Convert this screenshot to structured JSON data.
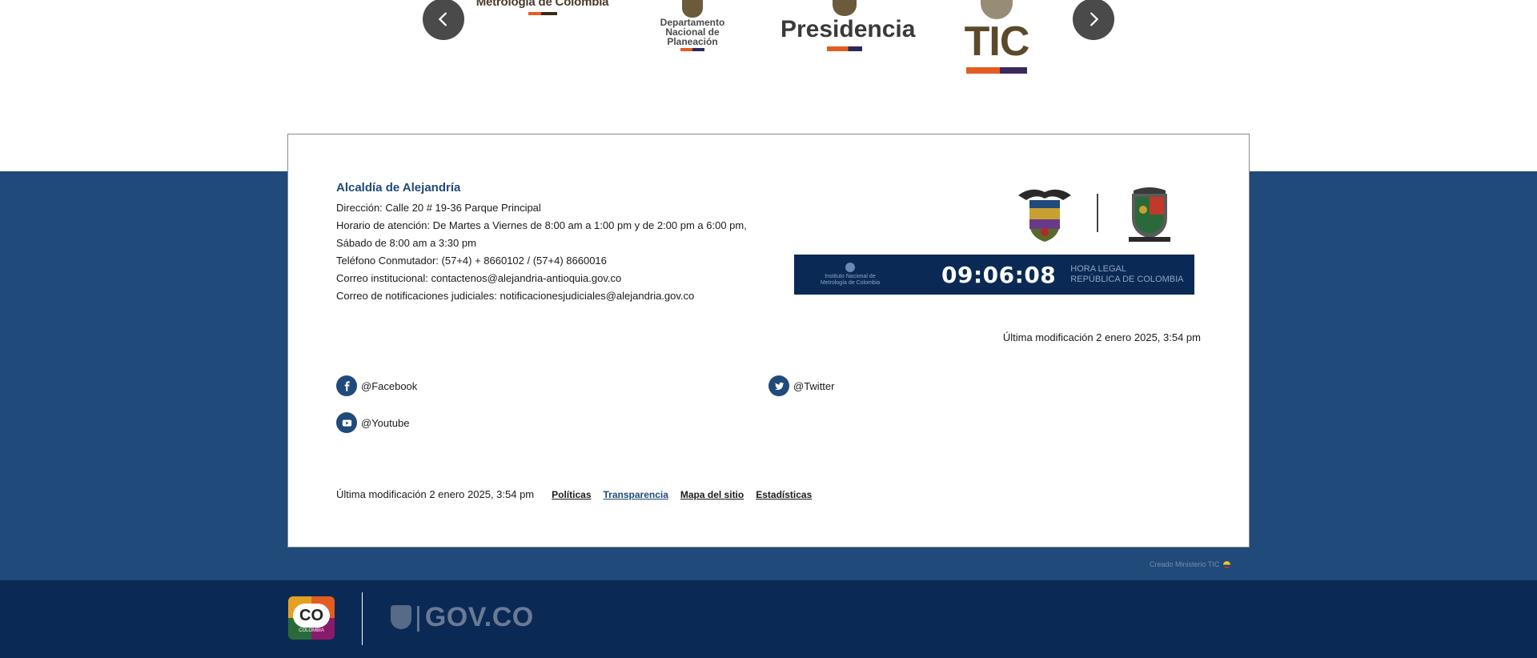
{
  "carousel": {
    "logos": {
      "metrologia": "Metrología de Colombia",
      "dnp_line1": "Departamento",
      "dnp_line2": "Nacional de Planeación",
      "presidencia": "Presidencia",
      "tic": "TIC"
    }
  },
  "footer": {
    "org_name": "Alcaldía de Alejandría",
    "address": "Dirección: Calle 20 # 19-36 Parque Principal",
    "hours_1": "Horario de atención: De Martes a Viernes de 8:00 am a 1:00 pm y de 2:00 pm a 6:00 pm,",
    "hours_2": "Sábado de 8:00 am a 3:30 pm",
    "phone": "Teléfono Conmutador: (57+4) + 8660102 / (57+4) 8660016",
    "email": "Correo institucional: contactenos@alejandria-antioquia.gov.co",
    "judicial_email": "Correo de notificaciones judiciales: notificacionesjudiciales@alejandria.gov.co",
    "clock": {
      "mini_logo_line1": "Instituto Nacional de",
      "mini_logo_line2": "Metrología de Colombia",
      "time": "09:06:08",
      "legal_line1": "HORA LEGAL",
      "legal_line2": "REPÚBLICA DE COLOMBIA"
    },
    "last_modified": "Última modificación 2 enero 2025, 3:54 pm",
    "social": {
      "facebook": "@Facebook",
      "twitter": "@Twitter",
      "youtube": "@Youtube"
    },
    "links": {
      "politicas": "Políticas",
      "transparencia": "Transparencia",
      "mapa": "Mapa del sitio",
      "estadisticas": "Estadísticas"
    },
    "credit": "Creado Ministerio TIC"
  },
  "bottom": {
    "co_text": "CO",
    "co_sub": "COLOMBIA",
    "pipe": "|",
    "govco": "GOV.CO"
  },
  "colors": {
    "brand_blue": "#1f4a7a",
    "dark_navy": "#0a2a55",
    "accent_orange": "#e35d23"
  }
}
